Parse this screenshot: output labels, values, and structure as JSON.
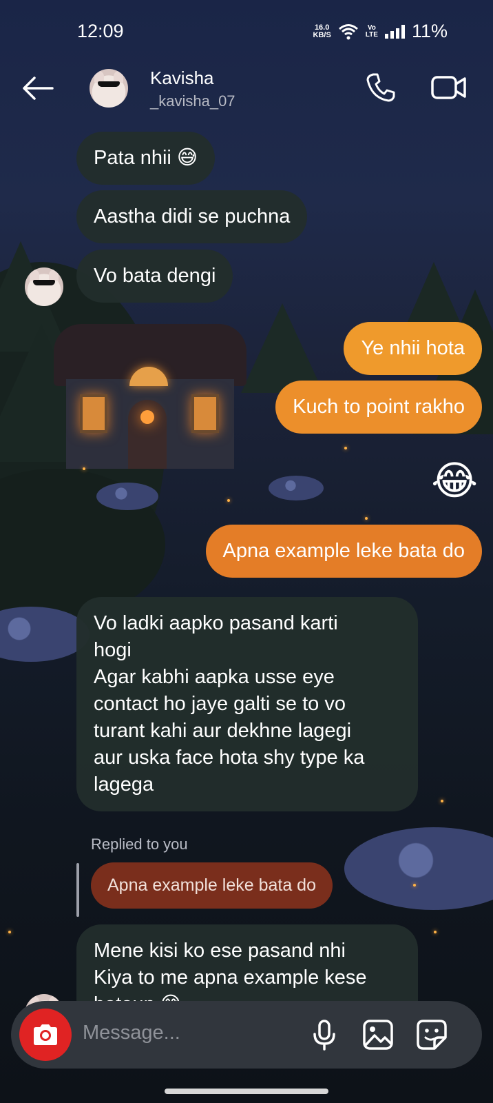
{
  "status_bar": {
    "time": "12:09",
    "speed_value": "16.0",
    "speed_unit": "KB/S",
    "volte_top": "Vo",
    "volte_bottom": "LTE",
    "battery": "11%"
  },
  "header": {
    "name": "Kavisha",
    "username": "_kavisha_07",
    "icons": [
      "back-arrow-icon",
      "phone-icon",
      "video-camera-icon"
    ]
  },
  "messages": [
    {
      "from": "them",
      "text": "Pata nhii 😅"
    },
    {
      "from": "them",
      "text": "Aastha didi se puchna"
    },
    {
      "from": "them",
      "text": "Vo bata dengi"
    },
    {
      "from": "me",
      "text": "Ye nhii hota"
    },
    {
      "from": "me",
      "text": "Kuch to point rakho"
    },
    {
      "from": "me",
      "text": "😂"
    },
    {
      "from": "me",
      "text": "Apna example leke bata do"
    },
    {
      "from": "them",
      "lines": [
        "Vo ladki aapko pasand karti",
        "hogi",
        "Agar kabhi aapka usse eye",
        "contact ho jaye galti se to vo",
        "turant kahi aur dekhne lagegi",
        "aur uska face hota shy type ka",
        "lagega"
      ]
    },
    {
      "from": "them",
      "reply_label": "Replied to you",
      "quoted": "Apna example leke bata do",
      "lines": [
        "Mene kisi ko ese pasand nhi",
        "Kiya to me apna example kese",
        "bataun 😅"
      ]
    }
  ],
  "composer": {
    "placeholder": "Message...",
    "icons": [
      "camera-icon",
      "microphone-icon",
      "gallery-icon",
      "sticker-icon"
    ]
  },
  "colors": {
    "accent_camera": "#e02323",
    "outgoing_bubble": "#ec8f2b",
    "incoming_bubble": "#222e2c",
    "reply_quote": "#7a2e1c"
  }
}
